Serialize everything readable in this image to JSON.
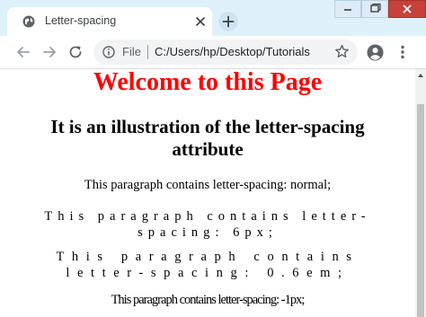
{
  "browser": {
    "tab": {
      "title": "Letter-spacing",
      "favicon": "globe-icon",
      "close_icon": "close-icon"
    },
    "new_tab_icon": "plus-icon",
    "window_controls": [
      "minimize-icon",
      "restore-icon",
      "close-icon"
    ],
    "toolbar": {
      "back_icon": "back-arrow-icon",
      "forward_icon": "forward-arrow-icon",
      "reload_icon": "reload-icon",
      "scheme_label": "File",
      "url": "C:/Users/hp/Desktop/Tutorials",
      "bookmark_icon": "star-icon",
      "profile_icon": "account-icon",
      "menu_icon": "kebab-menu-icon"
    },
    "colors": {
      "tab_strip": "#def1fa",
      "close_button": "#c7403a",
      "omnibox": "#f1f3f4"
    }
  },
  "page": {
    "heading": "Welcome to this Page",
    "heading_color": "#ff0000",
    "subheading": "It is an illustration of the letter-spacing attribute",
    "paragraphs": [
      "This paragraph contains letter-spacing: normal;",
      "This paragraph contains letter-spacing: 6px;",
      "This paragraph contains letter-spacing: 0.6em;",
      "This paragraph contains letter-spacing: -1px;"
    ]
  }
}
